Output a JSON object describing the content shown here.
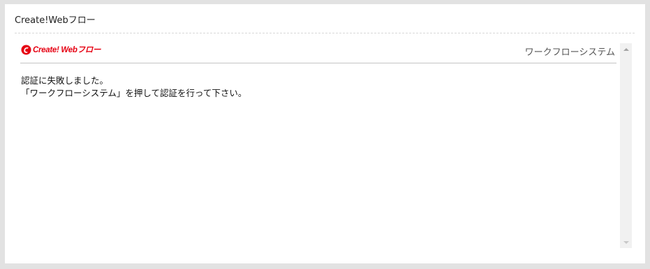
{
  "portlet": {
    "title": "Create!Webフロー"
  },
  "frame": {
    "logo_text": "Create! Webフロー",
    "logo_icon": "create-web-flow-logo-icon",
    "system_link": "ワークフローシステム",
    "message_lines": [
      "認証に失敗しました。",
      "「ワークフローシステム」を押して認証を行って下さい。"
    ]
  },
  "colors": {
    "brand_red": "#e60012",
    "page_background": "#e2e2e2",
    "panel_background": "#ffffff",
    "scrollbar_track": "#f1f1f1"
  }
}
